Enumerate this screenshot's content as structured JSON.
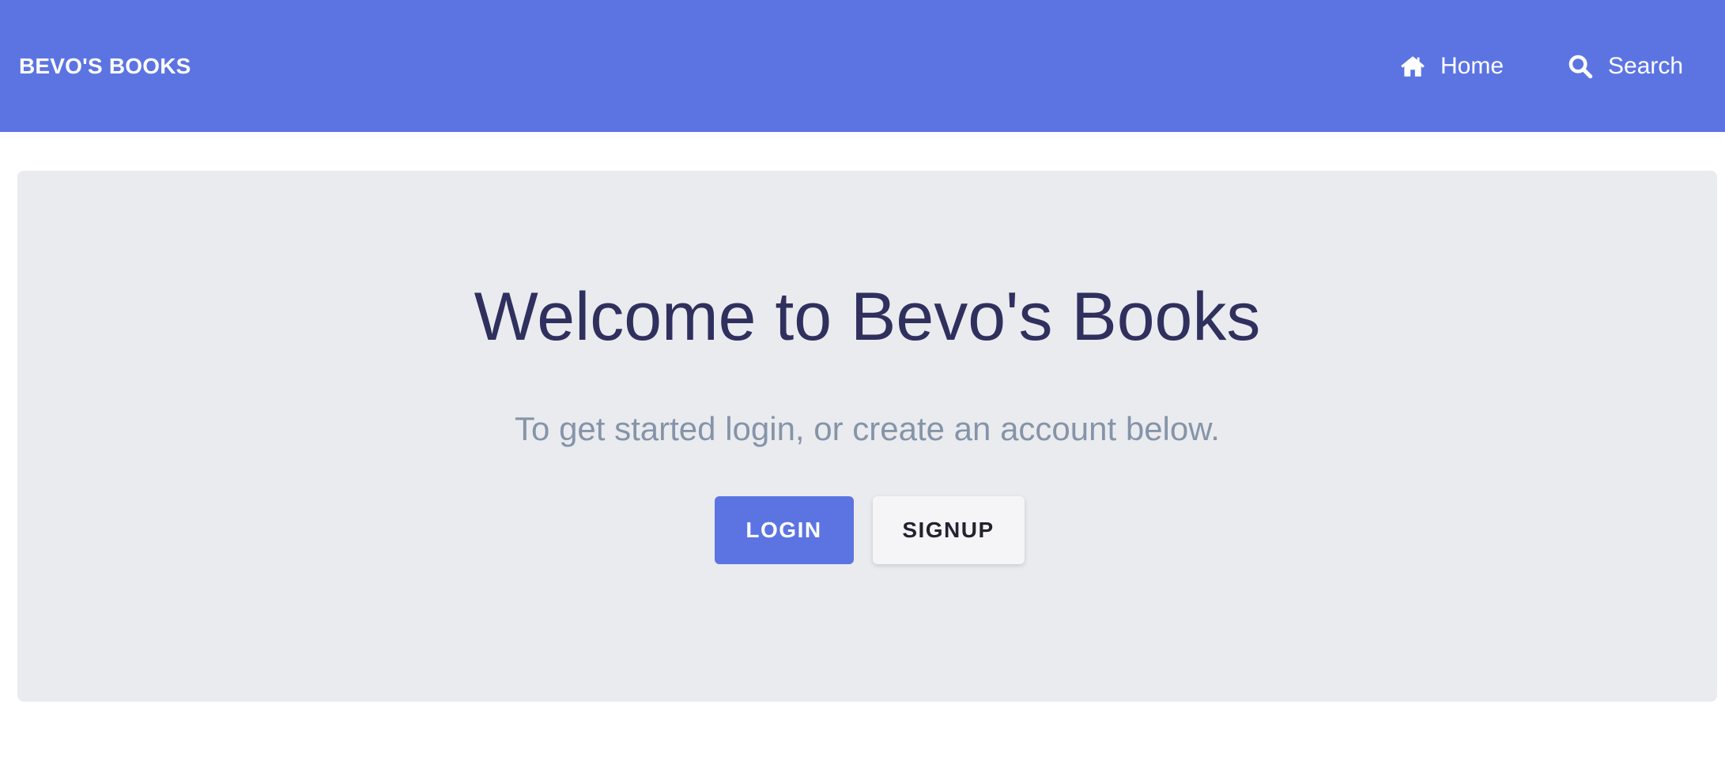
{
  "navbar": {
    "brand": "BEVO'S BOOKS",
    "items": [
      {
        "label": "Home",
        "icon": "home-icon"
      },
      {
        "label": "Search",
        "icon": "search-icon"
      }
    ]
  },
  "hero": {
    "title": "Welcome to Bevo's Books",
    "subtitle": "To get started login, or create an account below.",
    "buttons": {
      "login": "LOGIN",
      "signup": "SIGNUP"
    }
  },
  "colors": {
    "primary": "#5c74e2",
    "hero_background": "#eaebef",
    "title": "#30305e",
    "subtitle": "#8594a8"
  }
}
